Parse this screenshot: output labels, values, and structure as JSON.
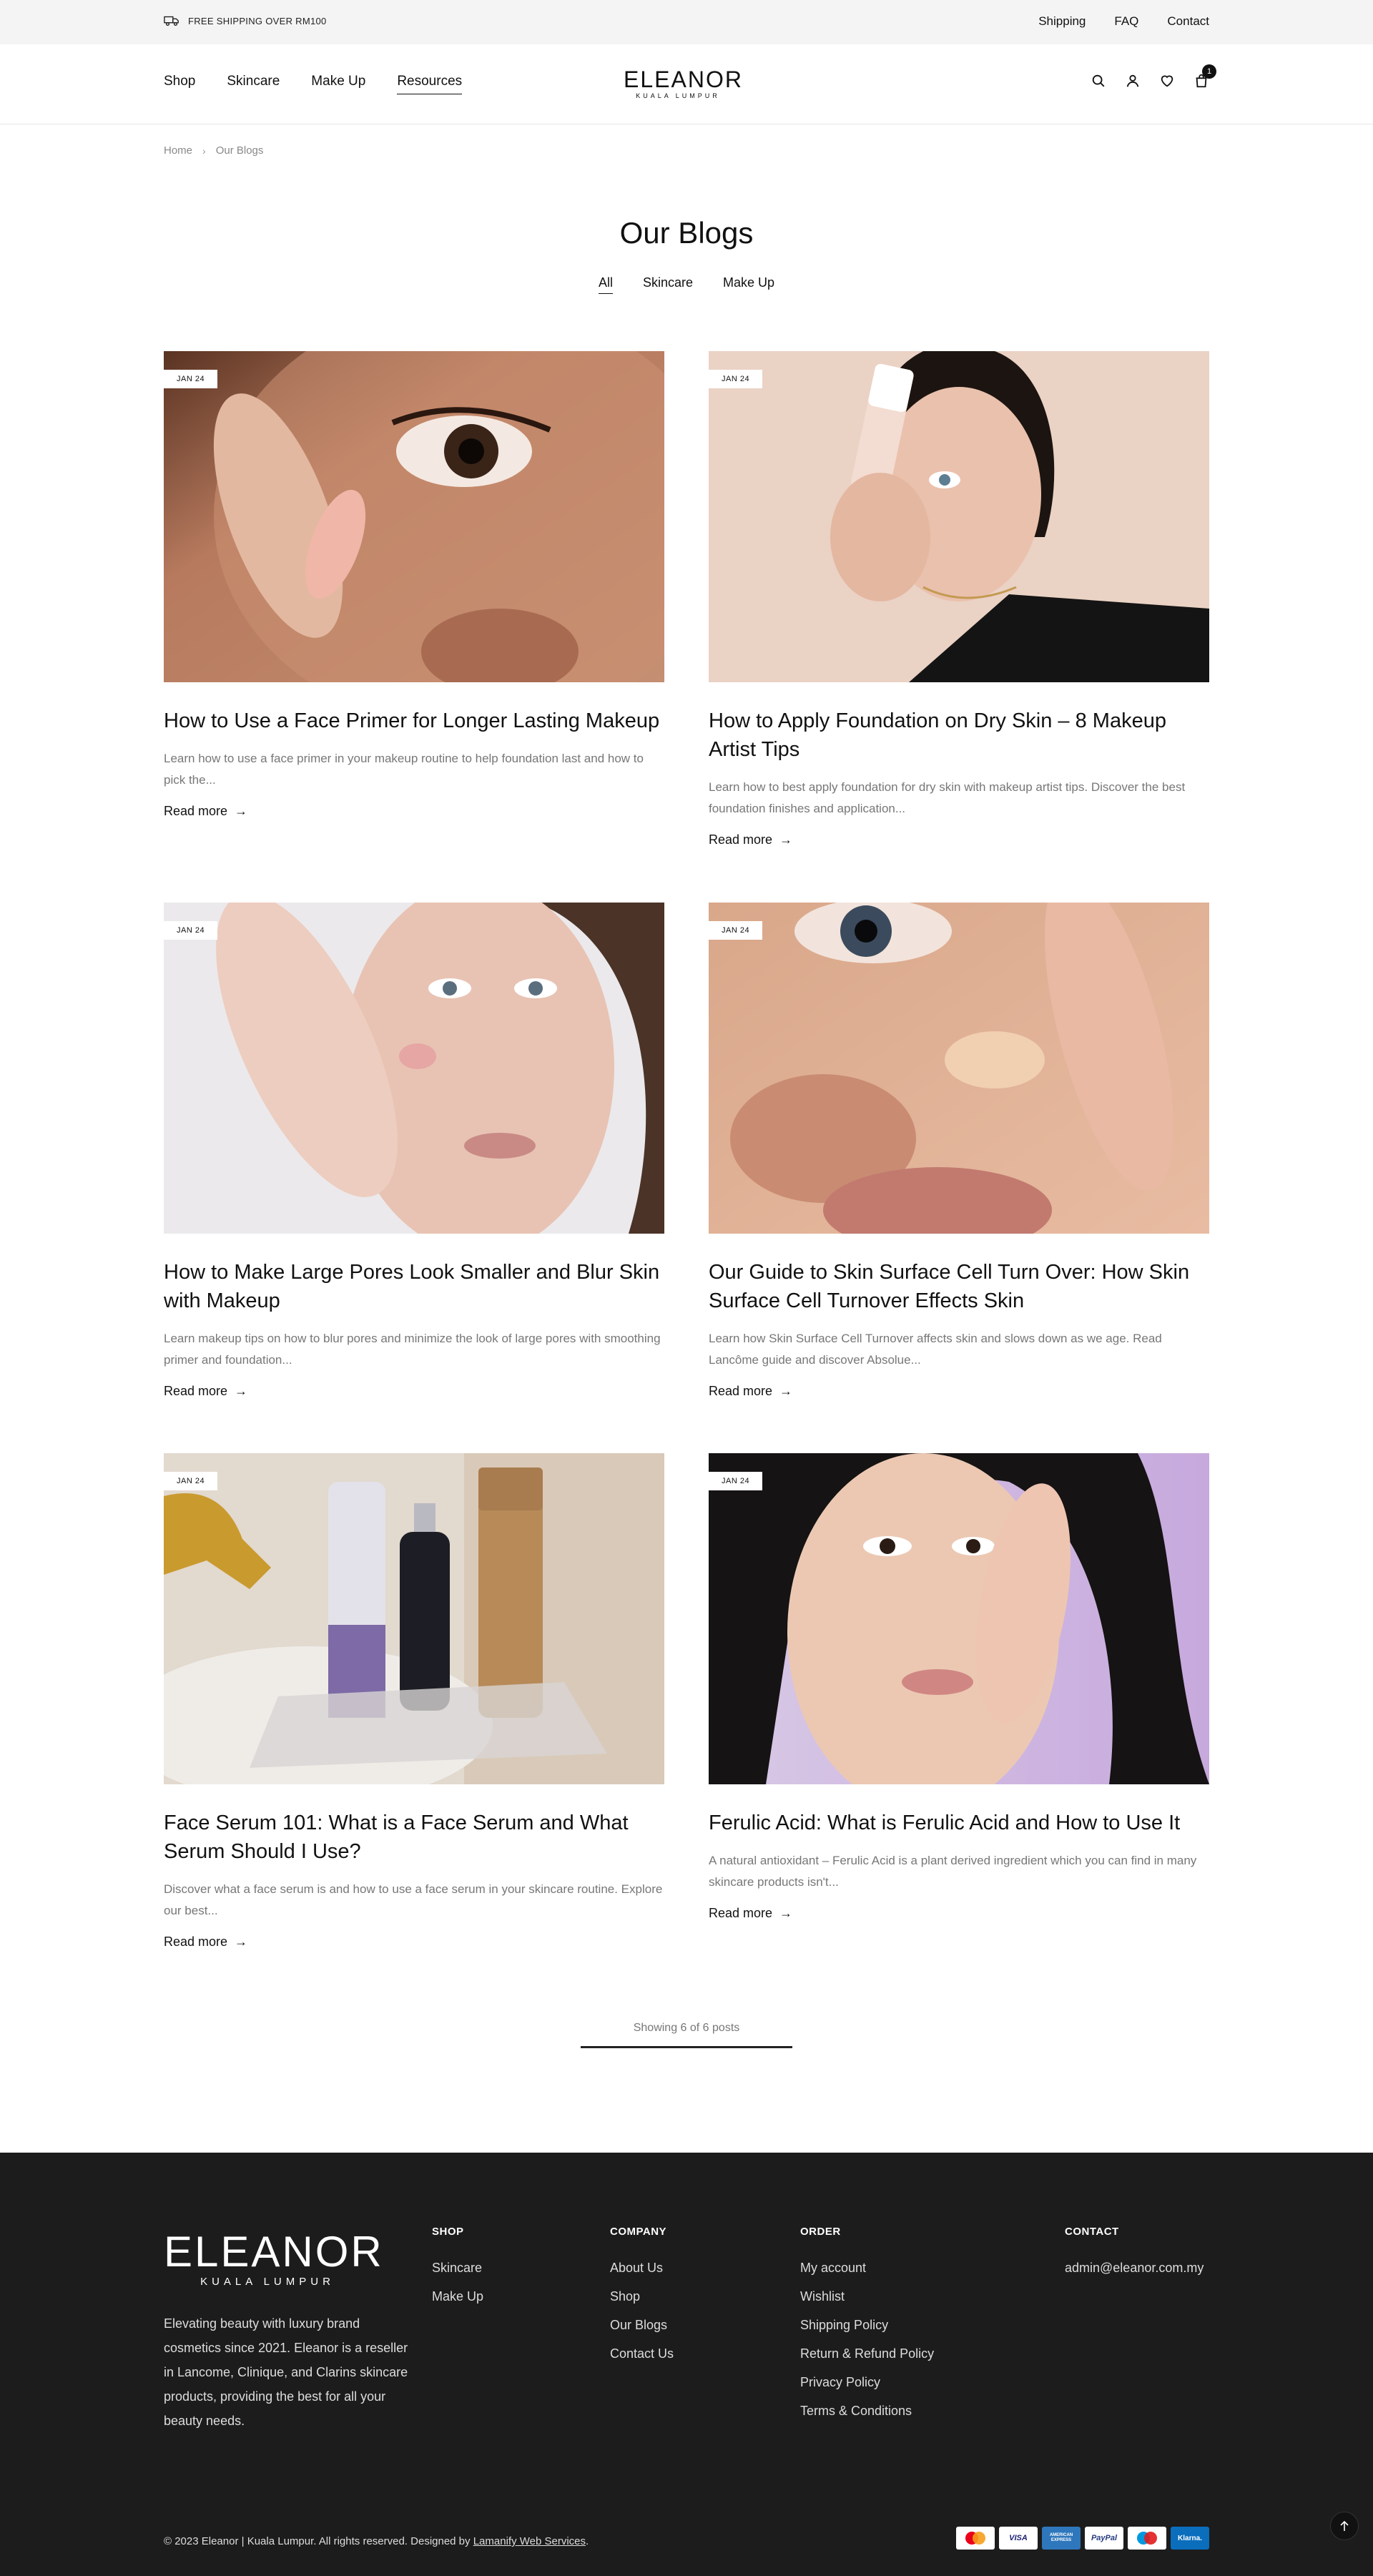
{
  "topbar": {
    "shipping_notice": "FREE SHIPPING OVER RM100",
    "links": [
      "Shipping",
      "FAQ",
      "Contact"
    ]
  },
  "header": {
    "nav": [
      "Shop",
      "Skincare",
      "Make Up",
      "Resources"
    ],
    "active_nav": "Resources",
    "logo_name": "ELEANOR",
    "logo_city": "KUALA LUMPUR",
    "cart_count": "1"
  },
  "breadcrumb": {
    "home": "Home",
    "current": "Our Blogs"
  },
  "page": {
    "title": "Our Blogs",
    "filters": [
      "All",
      "Skincare",
      "Make Up"
    ],
    "active_filter": "All",
    "read_more_label": "Read more",
    "showing_text": "Showing 6 of 6 posts"
  },
  "posts": [
    {
      "date": "JAN 24",
      "title": "How to Use a Face Primer for Longer Lasting Makeup",
      "excerpt": "Learn how to use a face primer in your makeup routine to help foundation last and how to pick the..."
    },
    {
      "date": "JAN 24",
      "title": "How to Apply Foundation on Dry Skin – 8 Makeup Artist Tips",
      "excerpt": "Learn how to best apply foundation for dry skin with makeup artist tips. Discover the best foundation finishes and application..."
    },
    {
      "date": "JAN 24",
      "title": "How to Make Large Pores Look Smaller and Blur Skin with Makeup",
      "excerpt": "Learn makeup tips on how to blur pores and minimize the look of large pores with smoothing primer and foundation..."
    },
    {
      "date": "JAN 24",
      "title": "Our Guide to Skin Surface Cell Turn Over: How Skin Surface Cell Turnover Effects Skin",
      "excerpt": "Learn how Skin Surface Cell Turnover affects skin and slows down as we age. Read Lancôme guide and discover Absolue..."
    },
    {
      "date": "JAN 24",
      "title": "Face Serum 101: What is a Face Serum and What Serum Should I Use?",
      "excerpt": "Discover what a face serum is and how to use a face serum in your skincare routine. Explore our best..."
    },
    {
      "date": "JAN 24",
      "title": "Ferulic Acid: What is Ferulic Acid and How to Use It",
      "excerpt": "A natural antioxidant – Ferulic Acid is a plant derived ingredient which you can find in many skincare products isn't..."
    }
  ],
  "footer": {
    "logo_name": "ELEANOR",
    "logo_city": "KUALA LUMPUR",
    "about": "Elevating beauty with luxury brand cosmetics since 2021. Eleanor is a reseller in Lancome, Clinique, and Clarins skincare products, providing the best for all your beauty needs.",
    "shop": {
      "heading": "SHOP",
      "links": [
        "Skincare",
        "Make Up"
      ]
    },
    "company": {
      "heading": "COMPANY",
      "links": [
        "About Us",
        "Shop",
        "Our Blogs",
        "Contact Us"
      ]
    },
    "order": {
      "heading": "ORDER",
      "links": [
        "My account",
        "Wishlist",
        "Shipping Policy",
        "Return & Refund Policy",
        "Privacy Policy",
        "Terms & Conditions"
      ]
    },
    "contact": {
      "heading": "CONTACT",
      "email": "admin@eleanor.com.my"
    },
    "copyright": "© 2023 Eleanor | Kuala Lumpur. All rights reserved. Designed by ",
    "designer": "Lamanify Web Services",
    "copyright_end": ".",
    "payments": [
      "mastercard-icon",
      "visa-icon",
      "amex-icon",
      "paypal-icon",
      "maestro-icon",
      "klarna-icon"
    ],
    "payment_labels": {
      "visa": "VISA",
      "amex": "AMERICAN EXPRESS",
      "paypal": "PayPal",
      "klarna": "Klarna."
    }
  }
}
